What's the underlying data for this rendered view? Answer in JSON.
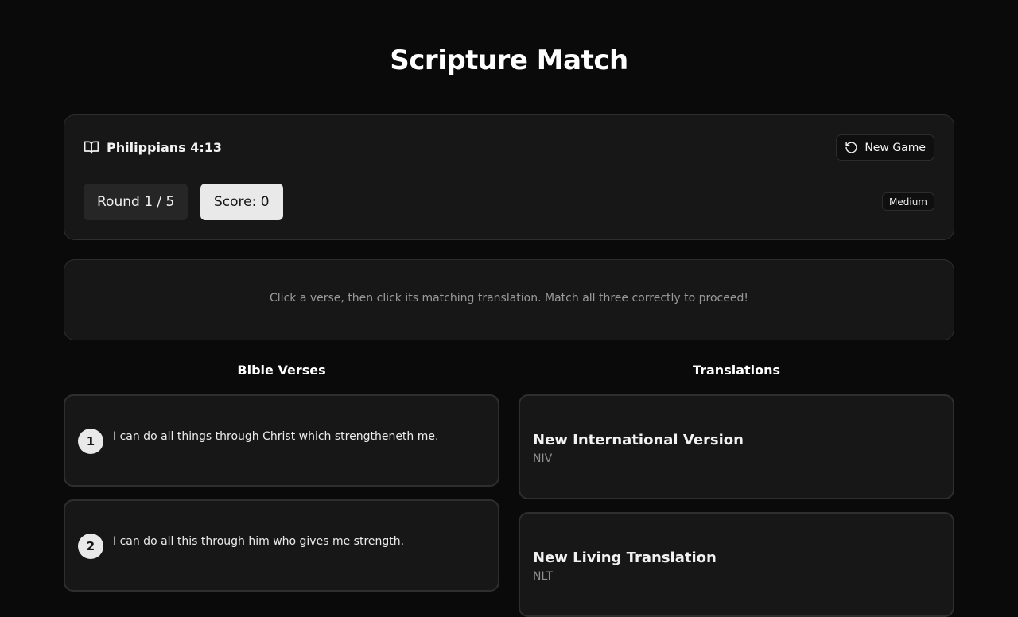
{
  "app": {
    "title": "Scripture Match"
  },
  "header": {
    "reference": "Philippians 4:13",
    "reference_icon": "book-open-icon",
    "new_game_label": "New Game",
    "new_game_icon": "rotate-ccw-icon",
    "round_label": "Round 1 / 5",
    "round_current": 1,
    "round_total": 5,
    "score_label": "Score: 0",
    "score": 0,
    "difficulty": "Medium"
  },
  "instructions": "Click a verse, then click its matching translation. Match all three correctly to proceed!",
  "verses": {
    "heading": "Bible Verses",
    "items": [
      {
        "number": "1",
        "text": "I can do all things through Christ which strengtheneth me."
      },
      {
        "number": "2",
        "text": "I can do all this through him who gives me strength."
      }
    ]
  },
  "translations": {
    "heading": "Translations",
    "items": [
      {
        "name": "New International Version",
        "abbr": "NIV"
      },
      {
        "name": "New Living Translation",
        "abbr": "NLT"
      }
    ]
  },
  "colors": {
    "background": "#0a0a0a",
    "card": "#171717",
    "border": "#2e2e2e",
    "accent_light": "#e9e9e9",
    "muted_text": "#9a9a9a"
  }
}
